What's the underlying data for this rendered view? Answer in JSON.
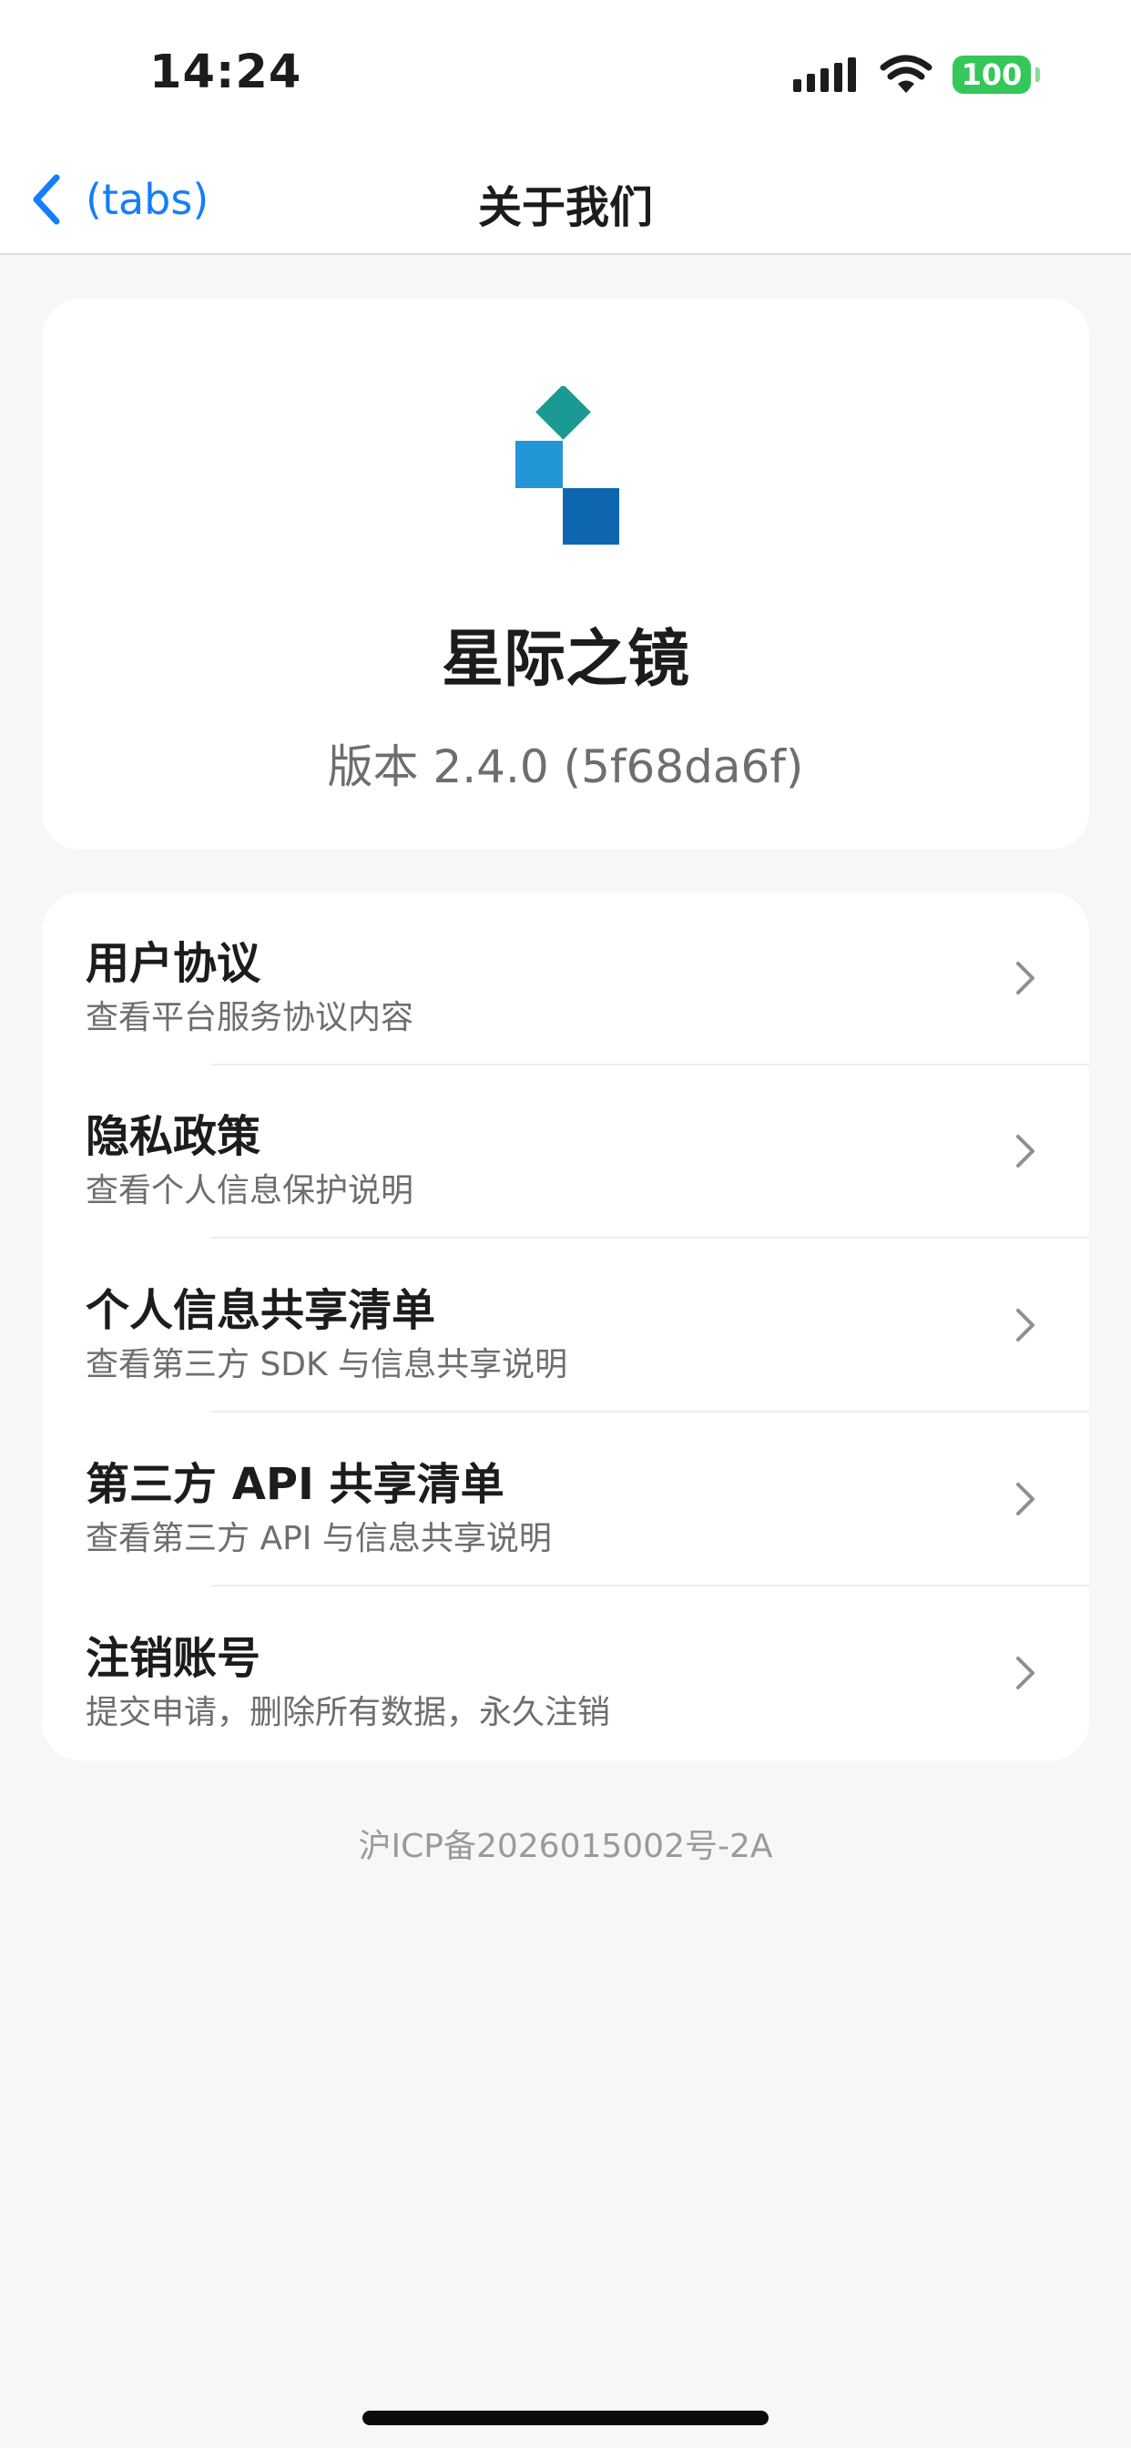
{
  "status_bar": {
    "time": "14:24",
    "battery": "100",
    "icons": [
      "signal-icon",
      "wifi-icon",
      "battery-icon"
    ]
  },
  "nav": {
    "back_label": "(tabs)",
    "title": "关于我们",
    "accent_color": "#147efb"
  },
  "app_info": {
    "name": "星际之镜",
    "version": "版本 2.4.0 (5f68da6f)",
    "logo_colors": [
      "#1a9a93",
      "#2296d6",
      "#0f66b0"
    ]
  },
  "menu": {
    "items": [
      {
        "title": "用户协议",
        "subtitle": "查看平台服务协议内容"
      },
      {
        "title": "隐私政策",
        "subtitle": "查看个人信息保护说明"
      },
      {
        "title": "个人信息共享清单",
        "subtitle": "查看第三方 SDK 与信息共享说明"
      },
      {
        "title": "第三方 API 共享清单",
        "subtitle": "查看第三方 API 与信息共享说明"
      },
      {
        "title": "注销账号",
        "subtitle": "提交申请，删除所有数据，永久注销"
      }
    ]
  },
  "footer": {
    "icp": "沪ICP备2026015002号-2A"
  }
}
